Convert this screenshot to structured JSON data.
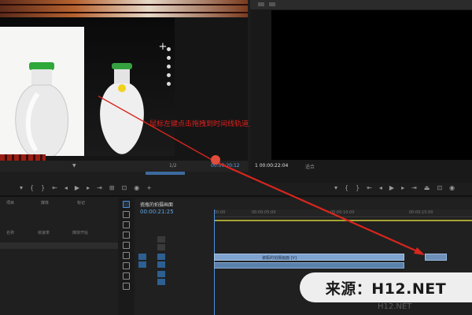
{
  "source_panel": {
    "annotation": "鼠标左键点击拖拽到时间线轨道上",
    "zoom_value": "1/2",
    "timecode": "00:00:20:12",
    "icons": [
      "add-icon",
      "settings-icon"
    ]
  },
  "program_monitor": {
    "timecode": "1 00:00:22:04",
    "fit_label": "适合"
  },
  "timeline": {
    "sequence_name": "瓷瓶的拍摄画面",
    "timecode": "00:00:21:25",
    "ruler_labels": [
      "00:00",
      "00:00:05:00",
      "00:00:10:00",
      "00:00:15:00"
    ],
    "clip_label": "瓷瓶的拍摄画面 [V]"
  },
  "project_panel": {
    "tabs": [
      "项目",
      "媒体",
      "标记"
    ],
    "columns": [
      "名称",
      "帧速率",
      "媒体开始"
    ]
  },
  "watermark": {
    "text": "来源：H12.NET",
    "faint_text": "H12.NET"
  },
  "colors": {
    "accent_blue": "#4b8fdd",
    "annotation_red": "#e0211d",
    "clip_blue": "#7ea3cf",
    "work_area": "#a8a332"
  }
}
